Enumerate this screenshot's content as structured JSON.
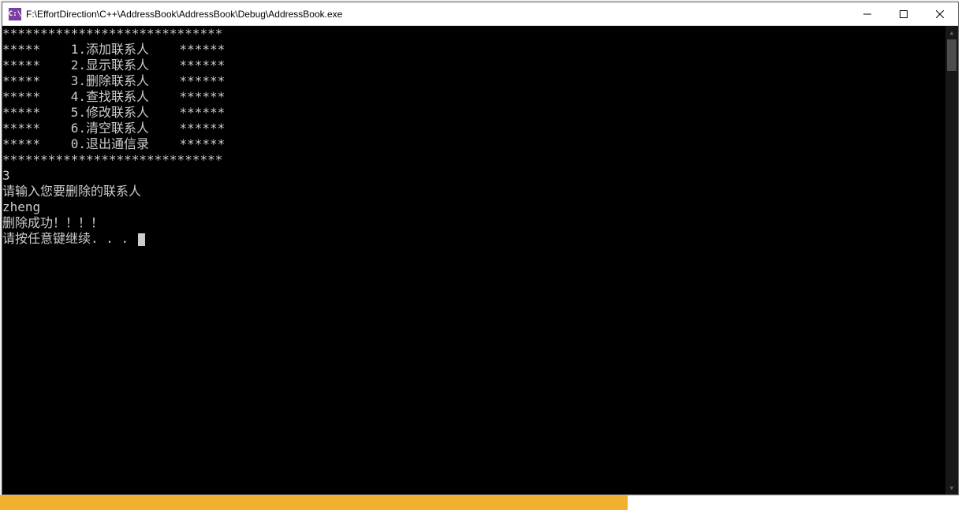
{
  "window": {
    "icon_text": "C:\\",
    "title": "F:\\EffortDirection\\C++\\AddressBook\\AddressBook\\Debug\\AddressBook.exe"
  },
  "console": {
    "border_top": "*****************************",
    "menu_items": [
      "*****    1.添加联系人    ******",
      "*****    2.显示联系人    ******",
      "*****    3.删除联系人    ******",
      "*****    4.查找联系人    ******",
      "*****    5.修改联系人    ******",
      "*****    6.清空联系人    ******",
      "*****    0.退出通信录    ******"
    ],
    "border_bottom": "*****************************",
    "input_choice": "3",
    "prompt_delete": "请输入您要删除的联系人",
    "input_name": "zheng",
    "result_msg": "删除成功！！！！",
    "continue_msg": "请按任意键继续. . . "
  }
}
